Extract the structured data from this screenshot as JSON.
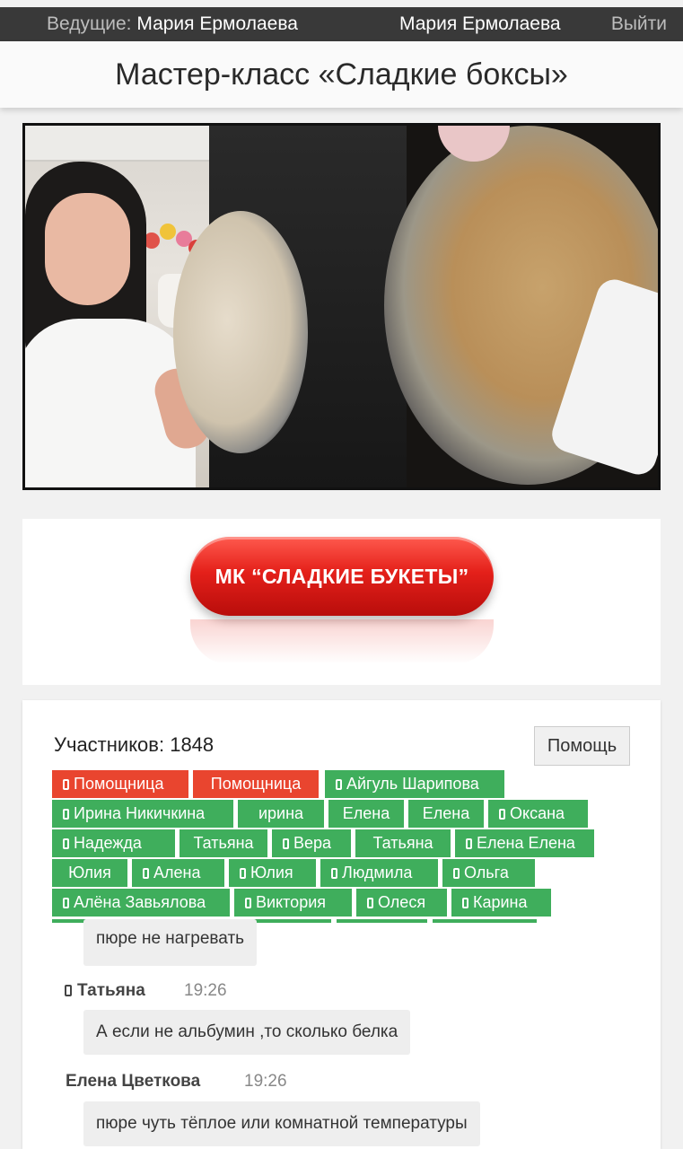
{
  "header": {
    "host_label": "Ведущие:",
    "host_name": "Мария Ермолаева",
    "user_name": "Мария Ермолаева",
    "logout": "Выйти"
  },
  "page": {
    "title": "Мастер-класс «Сладкие боксы»"
  },
  "video": {
    "description_icon": "video-stream"
  },
  "promo": {
    "button_label": "МК “СЛАДКИЕ БУКЕТЫ”"
  },
  "participants": {
    "label": "Участников: 1848",
    "help_button": "Помощь",
    "chips": [
      {
        "name": "Помощница",
        "color": "red",
        "phone": true
      },
      {
        "name": "Помощница",
        "color": "red",
        "phone": false
      },
      {
        "name": "Айгуль Шарипова",
        "color": "green",
        "phone": true
      },
      {
        "name": "Ирина Никичкина",
        "color": "green",
        "phone": true
      },
      {
        "name": "ирина",
        "color": "green",
        "phone": false
      },
      {
        "name": "Елена",
        "color": "green",
        "phone": false
      },
      {
        "name": "Елена",
        "color": "green",
        "phone": false
      },
      {
        "name": "Оксана",
        "color": "green",
        "phone": true
      },
      {
        "name": "Надежда",
        "color": "green",
        "phone": true
      },
      {
        "name": "Татьяна",
        "color": "green",
        "phone": false
      },
      {
        "name": "Вера",
        "color": "green",
        "phone": true
      },
      {
        "name": "Татьяна",
        "color": "green",
        "phone": false
      },
      {
        "name": "Елена Елена",
        "color": "green",
        "phone": true
      },
      {
        "name": "Юлия",
        "color": "green",
        "phone": false
      },
      {
        "name": "Алена",
        "color": "green",
        "phone": true
      },
      {
        "name": "Юлия",
        "color": "green",
        "phone": true
      },
      {
        "name": "Людмила",
        "color": "green",
        "phone": true
      },
      {
        "name": "Ольга",
        "color": "green",
        "phone": true
      },
      {
        "name": "Алёна Завьялова",
        "color": "green",
        "phone": true
      },
      {
        "name": "Виктория",
        "color": "green",
        "phone": true
      },
      {
        "name": "Олеся",
        "color": "green",
        "phone": true
      },
      {
        "name": "Карина",
        "color": "green",
        "phone": true
      }
    ]
  },
  "chat": {
    "messages": [
      {
        "text": "пюре не нагревать"
      },
      {
        "author": "Татьяна",
        "phone": true,
        "time": "19:26",
        "text": "А если не альбумин ,то сколько белка"
      },
      {
        "author": "Елена Цветкова",
        "phone": false,
        "time": "19:26",
        "text": "пюре чуть тёплое или комнатной температуры"
      }
    ]
  },
  "colors": {
    "chip_green": "#3fae5c",
    "chip_red": "#e9452f",
    "topbar": "#393939",
    "promo_red": "#e4201a"
  }
}
